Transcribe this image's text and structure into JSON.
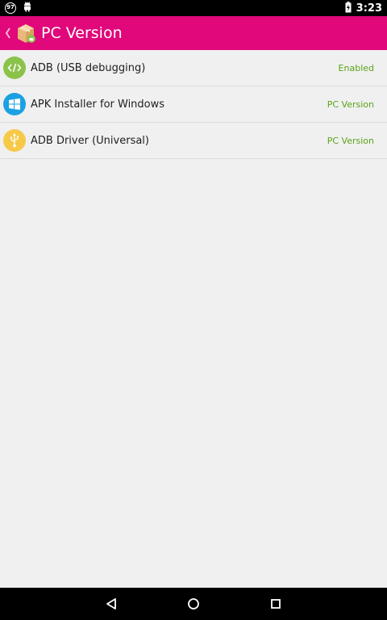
{
  "status_bar": {
    "notification_count": "97",
    "time": "3:23",
    "icons": [
      "notification-badge-icon",
      "android-icon",
      "battery-charging-icon"
    ]
  },
  "app_bar": {
    "title": "PC Version",
    "color": "#e0087a",
    "icons": [
      "back-chevron-icon",
      "package-box-icon"
    ]
  },
  "list": {
    "items": [
      {
        "label": "ADB (USB debugging)",
        "status": "Enabled",
        "icon": "code-icon",
        "icon_color": "#8bc34a"
      },
      {
        "label": "APK Installer for Windows",
        "status": "PC Version",
        "icon": "windows-icon",
        "icon_color": "#1ba1e2"
      },
      {
        "label": "ADB Driver (Universal)",
        "status": "PC Version",
        "icon": "usb-icon",
        "icon_color": "#f7c948"
      }
    ],
    "status_color": "#5aa318"
  },
  "nav_bar": {
    "icons": [
      "back-triangle-icon",
      "home-circle-icon",
      "recents-square-icon"
    ]
  }
}
